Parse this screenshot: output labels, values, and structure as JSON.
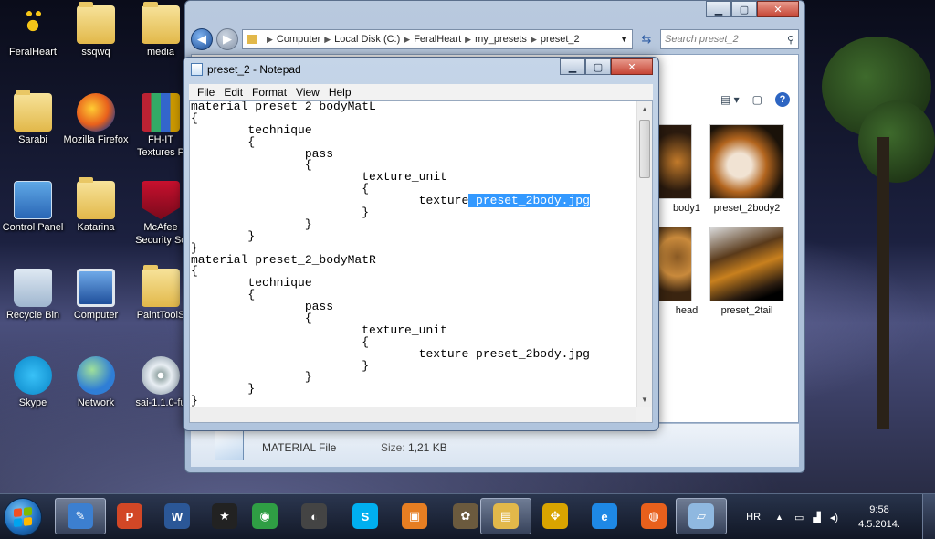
{
  "desktop": {
    "icons": [
      {
        "label": "FeralHeart",
        "icon": "paw-icon"
      },
      {
        "label": "ssqwq",
        "icon": "folder-icon"
      },
      {
        "label": "media",
        "icon": "folder-icon"
      },
      {
        "label": "Sarabi",
        "icon": "folder-icon"
      },
      {
        "label": "Mozilla Firefox",
        "icon": "firefox-icon"
      },
      {
        "label": "FH-IT Textures P",
        "icon": "winrar-icon"
      },
      {
        "label": "Control Panel",
        "icon": "control-panel-icon"
      },
      {
        "label": "Katarina",
        "icon": "user-folder-icon"
      },
      {
        "label": "McAfee Security Sc",
        "icon": "mcafee-icon"
      },
      {
        "label": "Recycle Bin",
        "icon": "recycle-bin-icon"
      },
      {
        "label": "Computer",
        "icon": "computer-icon"
      },
      {
        "label": "PaintToolS",
        "icon": "folder-icon"
      },
      {
        "label": "Skype",
        "icon": "skype-icon"
      },
      {
        "label": "Network",
        "icon": "network-icon"
      },
      {
        "label": "sai-1.1.0-fu",
        "icon": "installer-disc-icon"
      }
    ]
  },
  "explorer": {
    "breadcrumb": [
      "Computer",
      "Local Disk (C:)",
      "FeralHeart",
      "my_presets",
      "preset_2"
    ],
    "search_placeholder": "Search preset_2",
    "files": [
      {
        "name": "body1"
      },
      {
        "name": "preset_2body2"
      },
      {
        "name": "head"
      },
      {
        "name": "preset_2tail"
      }
    ],
    "details": {
      "type": "MATERIAL File",
      "size_label": "Size:",
      "size": "1,21 KB"
    }
  },
  "notepad": {
    "title": "preset_2 - Notepad",
    "menu": [
      "File",
      "Edit",
      "Format",
      "View",
      "Help"
    ],
    "lines": [
      {
        "text": "material preset_2_bodyMatL"
      },
      {
        "text": "{"
      },
      {
        "text": "        technique"
      },
      {
        "text": "        {"
      },
      {
        "text": "                pass"
      },
      {
        "text": "                {"
      },
      {
        "text": "                        texture_unit"
      },
      {
        "text": "                        {"
      },
      {
        "text": "                                texture",
        "selected": " preset_2body.jpg"
      },
      {
        "text": "                        }"
      },
      {
        "text": "                }"
      },
      {
        "text": "        }"
      },
      {
        "text": "}"
      },
      {
        "text": "material preset_2_bodyMatR"
      },
      {
        "text": "{"
      },
      {
        "text": "        technique"
      },
      {
        "text": "        {"
      },
      {
        "text": "                pass"
      },
      {
        "text": "                {"
      },
      {
        "text": "                        texture_unit"
      },
      {
        "text": "                        {"
      },
      {
        "text": "                                texture preset_2body.jpg"
      },
      {
        "text": "                        }"
      },
      {
        "text": "                }"
      },
      {
        "text": "        }"
      },
      {
        "text": "}"
      }
    ]
  },
  "taskbar": {
    "apps": [
      {
        "name": "paint-tool-icon",
        "color": "#3c7fd0",
        "glyph": "✎",
        "active": true
      },
      {
        "name": "powerpoint-icon",
        "color": "#d24726",
        "glyph": "P",
        "active": false
      },
      {
        "name": "word-icon",
        "color": "#2b5797",
        "glyph": "W",
        "active": false
      },
      {
        "name": "movie-star-icon",
        "color": "#222222",
        "glyph": "★",
        "active": false
      },
      {
        "name": "chrome-icon",
        "color": "#2f9e44",
        "glyph": "◉",
        "active": false
      },
      {
        "name": "photoscape-icon",
        "color": "#444444",
        "glyph": "◐",
        "active": false
      },
      {
        "name": "skype-icon",
        "color": "#00aff0",
        "glyph": "S",
        "active": false
      },
      {
        "name": "paint-app-icon",
        "color": "#e67e22",
        "glyph": "▣",
        "active": false
      },
      {
        "name": "gimp-icon",
        "color": "#6b5a3e",
        "glyph": "✿",
        "active": false
      },
      {
        "name": "explorer-folder-icon",
        "color": "#e2b84a",
        "glyph": "▤",
        "active": true
      },
      {
        "name": "feralheart-paw-icon",
        "color": "#d9a400",
        "glyph": "✥",
        "active": false
      },
      {
        "name": "internet-explorer-icon",
        "color": "#1e88e5",
        "glyph": "e",
        "active": false
      },
      {
        "name": "firefox-icon",
        "color": "#e8601c",
        "glyph": "◍",
        "active": false
      },
      {
        "name": "notepad-icon",
        "color": "#8fb8e0",
        "glyph": "▱",
        "active": true
      }
    ],
    "language": "HR",
    "time": "9:58",
    "date": "4.5.2014."
  }
}
